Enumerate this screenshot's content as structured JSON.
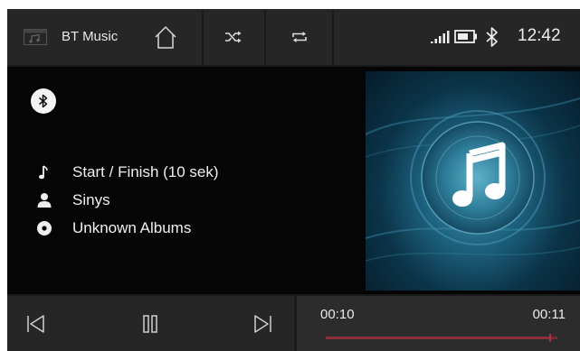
{
  "header": {
    "app_title": "BT Music",
    "app_icon": "music-folder-icon",
    "home_icon": "home-icon",
    "shuffle_icon": "shuffle-icon",
    "repeat_icon": "repeat-icon"
  },
  "status": {
    "signal_icon": "signal-icon",
    "battery_icon": "battery-icon",
    "bluetooth_icon": "bluetooth-icon",
    "time": "12:42"
  },
  "now_playing": {
    "source_icon": "bluetooth-icon",
    "track": "Start / Finish (10 sek)",
    "artist": "Sinys",
    "album": "Unknown Albums",
    "album_art": "music-note-icon"
  },
  "playback": {
    "prev_icon": "skip-previous-icon",
    "pause_icon": "pause-icon",
    "next_icon": "skip-next-icon",
    "elapsed": "00:10",
    "total": "00:11",
    "progress": 0.97
  },
  "colors": {
    "panel": "#262626",
    "background": "#050505",
    "accent": "#8d2e38"
  }
}
